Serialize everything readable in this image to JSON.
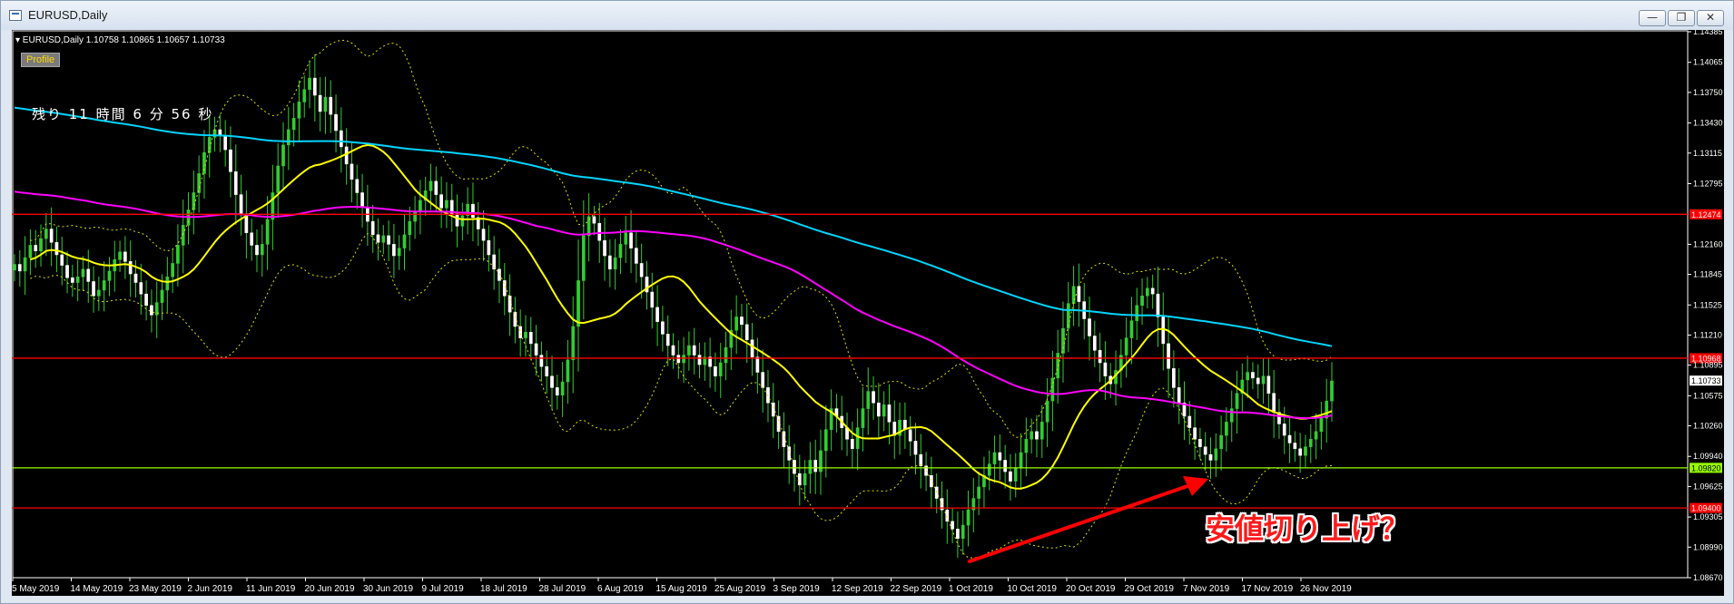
{
  "window": {
    "title": "EURUSD,Daily",
    "buttons": {
      "minimize": "—",
      "restore": "❐",
      "close": "✕"
    }
  },
  "chart_header": {
    "text": "▾ EURUSD,Daily  1.10758 1.10865 1.10657 1.10733"
  },
  "profile_label": "Profile",
  "countdown_text": "残り 11 時間 6 分 56 秒",
  "annotation_text": "安値切り上げ？",
  "colors": {
    "background": "#000000",
    "bull_candle": "#33cc33",
    "bear_candle": "#ffffff",
    "ma_short": "#ffff00",
    "ma_mid": "#ff00ff",
    "ma_long": "#00d5ff",
    "bollinger": "#e0e000",
    "red_level": "#ff0000",
    "green_level": "#99ff00",
    "arrow": "#ff0000"
  },
  "chart_data": {
    "type": "candlestick",
    "symbol": "EURUSD",
    "timeframe": "Daily",
    "last_bar": {
      "open": 1.10758,
      "high": 1.10865,
      "low": 1.10657,
      "close": 1.10733
    },
    "price_axis": {
      "ticks": [
        "1.14385",
        "1.14065",
        "1.13750",
        "1.13430",
        "1.13115",
        "1.12795",
        "1.12160",
        "1.11845",
        "1.11525",
        "1.11210",
        "1.10895",
        "1.10575",
        "1.10260",
        "1.09940",
        "1.09625",
        "1.09305",
        "1.08990",
        "1.08670"
      ],
      "ylim": [
        1.0867,
        1.14385
      ]
    },
    "time_axis": {
      "ticks": [
        "5 May 2019",
        "14 May 2019",
        "23 May 2019",
        "2 Jun 2019",
        "11 Jun 2019",
        "20 Jun 2019",
        "30 Jun 2019",
        "9 Jul 2019",
        "18 Jul 2019",
        "28 Jul 2019",
        "6 Aug 2019",
        "15 Aug 2019",
        "25 Aug 2019",
        "3 Sep 2019",
        "12 Sep 2019",
        "22 Sep 2019",
        "1 Oct 2019",
        "10 Oct 2019",
        "20 Oct 2019",
        "29 Oct 2019",
        "7 Nov 2019",
        "17 Nov 2019",
        "26 Nov 2019"
      ]
    },
    "horizontal_lines": [
      {
        "price": 1.12474,
        "label": "1.12474",
        "color": "red"
      },
      {
        "price": 1.10968,
        "label": "1.10968",
        "color": "red"
      },
      {
        "price": 1.0982,
        "label": "1.09820",
        "color": "green"
      },
      {
        "price": 1.094,
        "label": "1.09400",
        "color": "red"
      }
    ],
    "current_price_label": "1.10733",
    "closes": [
      1.1195,
      1.1188,
      1.1202,
      1.1215,
      1.1209,
      1.1222,
      1.1232,
      1.1218,
      1.1205,
      1.1194,
      1.1181,
      1.1176,
      1.1182,
      1.119,
      1.1177,
      1.1162,
      1.1168,
      1.1178,
      1.1188,
      1.12,
      1.1208,
      1.1198,
      1.1185,
      1.1176,
      1.1164,
      1.1152,
      1.1142,
      1.1155,
      1.1168,
      1.1182,
      1.1196,
      1.1215,
      1.1236,
      1.1252,
      1.127,
      1.129,
      1.1312,
      1.1328,
      1.1336,
      1.133,
      1.1315,
      1.1292,
      1.1268,
      1.1248,
      1.1228,
      1.1215,
      1.1205,
      1.1216,
      1.1242,
      1.127,
      1.1298,
      1.132,
      1.1336,
      1.1348,
      1.1365,
      1.1378,
      1.139,
      1.1372,
      1.1355,
      1.137,
      1.1352,
      1.1335,
      1.1318,
      1.13,
      1.1284,
      1.127,
      1.1255,
      1.124,
      1.1226,
      1.1218,
      1.1225,
      1.1216,
      1.1204,
      1.1212,
      1.1226,
      1.124,
      1.125,
      1.1262,
      1.1272,
      1.1282,
      1.1268,
      1.1254,
      1.1262,
      1.1248,
      1.1235,
      1.1246,
      1.1258,
      1.1244,
      1.1232,
      1.122,
      1.1205,
      1.119,
      1.1178,
      1.1162,
      1.1145,
      1.113,
      1.1118,
      1.1124,
      1.1112,
      1.11,
      1.1088,
      1.1078,
      1.1066,
      1.1058,
      1.1072,
      1.1095,
      1.113,
      1.1178,
      1.1225,
      1.1245,
      1.1238,
      1.122,
      1.1204,
      1.119,
      1.1202,
      1.1216,
      1.1228,
      1.1212,
      1.1196,
      1.1182,
      1.1166,
      1.115,
      1.1135,
      1.1122,
      1.111,
      1.11,
      1.1092,
      1.11,
      1.111,
      1.11,
      1.109,
      1.1098,
      1.1088,
      1.1078,
      1.1092,
      1.1108,
      1.1126,
      1.114,
      1.1132,
      1.1116,
      1.1098,
      1.1082,
      1.1066,
      1.105,
      1.1036,
      1.102,
      1.1004,
      1.099,
      1.0976,
      1.0964,
      1.0976,
      1.099,
      1.0978,
      1.1,
      1.1022,
      1.1044,
      1.1036,
      1.1024,
      1.1012,
      1.1002,
      1.1024,
      1.1044,
      1.1062,
      1.105,
      1.1036,
      1.1048,
      1.103,
      1.1016,
      1.1032,
      1.1022,
      1.101,
      1.0996,
      1.0984,
      1.0974,
      1.0962,
      1.095,
      1.0938,
      1.0926,
      1.0918,
      1.0908,
      1.0922,
      1.0938,
      1.095,
      1.0962,
      1.0974,
      1.0986,
      1.0998,
      1.099,
      1.0978,
      1.0968,
      1.0982,
      1.0998,
      1.1012,
      1.102,
      1.1012,
      1.103,
      1.1052,
      1.1076,
      1.1102,
      1.1128,
      1.1154,
      1.1172,
      1.1156,
      1.1138,
      1.112,
      1.1105,
      1.1092,
      1.1078,
      1.107,
      1.1084,
      1.11,
      1.1118,
      1.1136,
      1.1152,
      1.1162,
      1.117,
      1.1164,
      1.114,
      1.1112,
      1.1086,
      1.1066,
      1.105,
      1.1036,
      1.1024,
      1.1012,
      1.1004,
      1.0996,
      1.099,
      1.1002,
      1.1016,
      1.103,
      1.1044,
      1.106,
      1.1074,
      1.1082,
      1.1076,
      1.107,
      1.1078,
      1.106,
      1.104,
      1.1028,
      1.1016,
      1.1008,
      1.1002,
      1.0995,
      1.1004,
      1.1012,
      1.102,
      1.1034,
      1.1052,
      1.1073
    ]
  }
}
